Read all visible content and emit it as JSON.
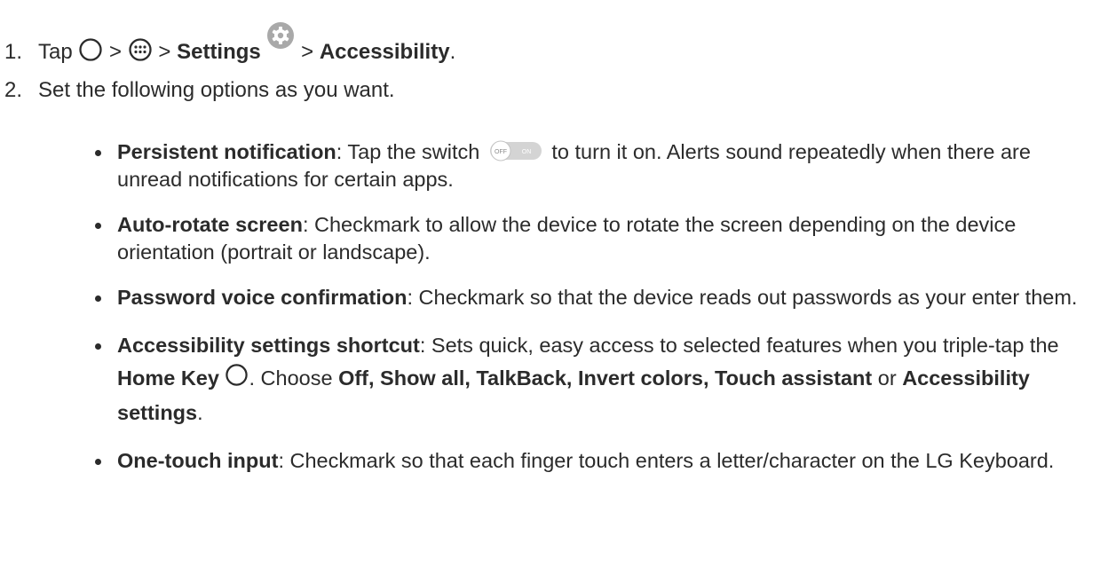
{
  "step1": {
    "number": "1.",
    "tap": "Tap",
    "sep": ">",
    "settings": "Settings",
    "accessibility": "Accessibility",
    "end": ".",
    "icons": [
      "home-circle-icon",
      "apps-grid-icon",
      "settings-gear-icon"
    ]
  },
  "step2": {
    "number": "2.",
    "text": "Set the following options as you want."
  },
  "bullets": [
    {
      "title": "Persistent notification",
      "pre": ": Tap the switch",
      "toggle": {
        "off": "OFF",
        "on": "ON"
      },
      "post": " to turn it on. Alerts sound repeatedly when there are unread notifications for certain apps."
    },
    {
      "title": "Auto-rotate screen",
      "text": ": Checkmark to allow the device to rotate the screen depending on the device orientation (portrait or landscape)."
    },
    {
      "title": "Password voice confirmation",
      "text": ": Checkmark so that the device reads out passwords as your enter them."
    },
    {
      "title": "Accessibility settings shortcut",
      "text1": ": Sets quick, easy access to selected features when you triple-tap the ",
      "home_key": "Home Key",
      "text2": ". Choose ",
      "options": "Off, Show all, TalkBack, Invert colors, Touch assistant",
      "or": " or ",
      "last": "Accessibility settings",
      "end": "."
    },
    {
      "title": "One-touch input",
      "text": ": Checkmark so that each finger touch enters a letter/character on the LG Keyboard."
    }
  ],
  "colors": {
    "text": "#2b2b2b",
    "gear_badge": "#a9a9a9",
    "toggle_track": "#d4d4d4"
  }
}
